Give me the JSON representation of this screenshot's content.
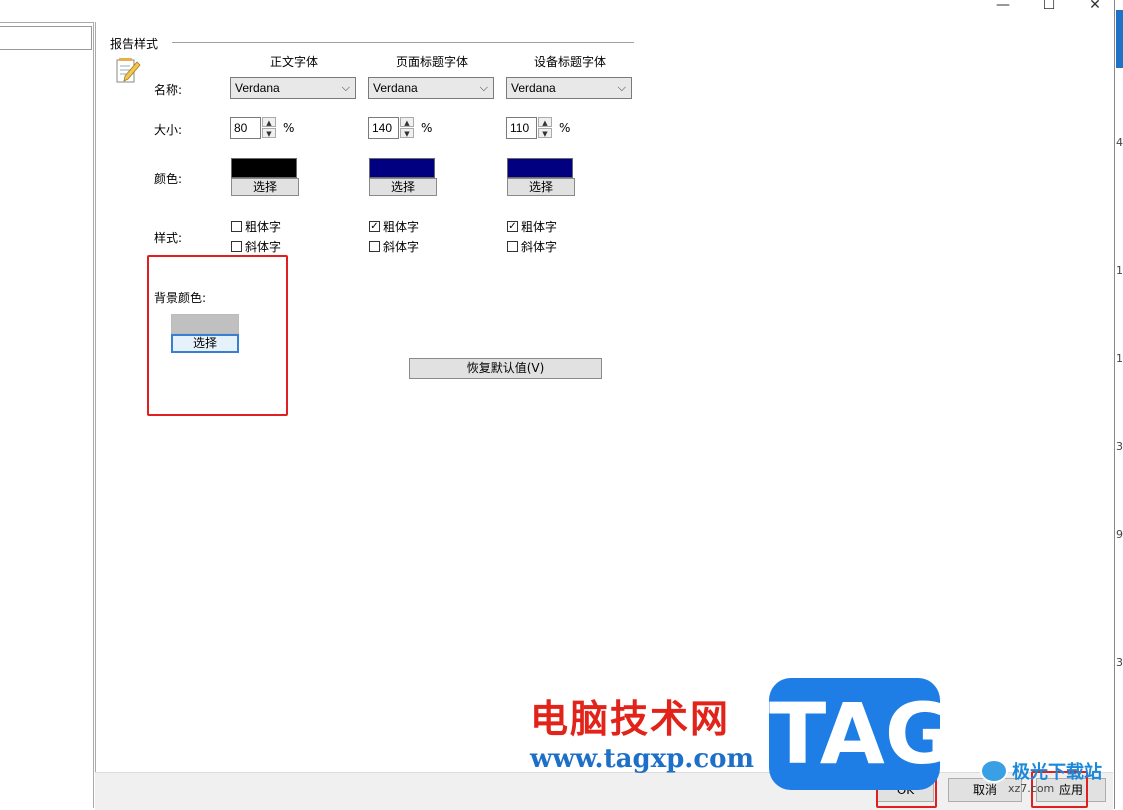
{
  "window": {
    "minimize_glyph": "—",
    "maximize_glyph": "☐",
    "close_glyph": "✕"
  },
  "group": {
    "title": "报告样式"
  },
  "columns": [
    {
      "header": "正文字体",
      "font": "Verdana",
      "size": "80",
      "color": "#000000",
      "bold": false,
      "italic": false
    },
    {
      "header": "页面标题字体",
      "font": "Verdana",
      "size": "140",
      "color": "#000080",
      "bold": true,
      "italic": false
    },
    {
      "header": "设备标题字体",
      "font": "Verdana",
      "size": "110",
      "color": "#000080",
      "bold": true,
      "italic": false
    }
  ],
  "labels": {
    "name": "名称:",
    "size": "大小:",
    "color": "颜色:",
    "style": "样式:",
    "percent": "%",
    "pick": "选择",
    "bold": "粗体字",
    "italic": "斜体字",
    "bg_color": "背景颜色:"
  },
  "background": {
    "color": "#c0c0c0"
  },
  "buttons": {
    "restore_defaults": "恢复默认值(V)",
    "ok": "OK",
    "cancel": "取消",
    "apply": "应用"
  },
  "right_fragments": [
    "4",
    "1",
    "1",
    "3",
    "9",
    "3"
  ],
  "watermark": {
    "site_name": "电脑技术网",
    "url": "www.tagxp.com",
    "tag": "TAG",
    "corner_text": "极光下载站",
    "corner_sub": "xz7.com"
  },
  "icon": {
    "name": "notepad-pencil-icon"
  },
  "accents": {
    "highlight_red": "#e02020",
    "brand_blue": "#1e7ee6",
    "brand_red": "#e2231a"
  }
}
